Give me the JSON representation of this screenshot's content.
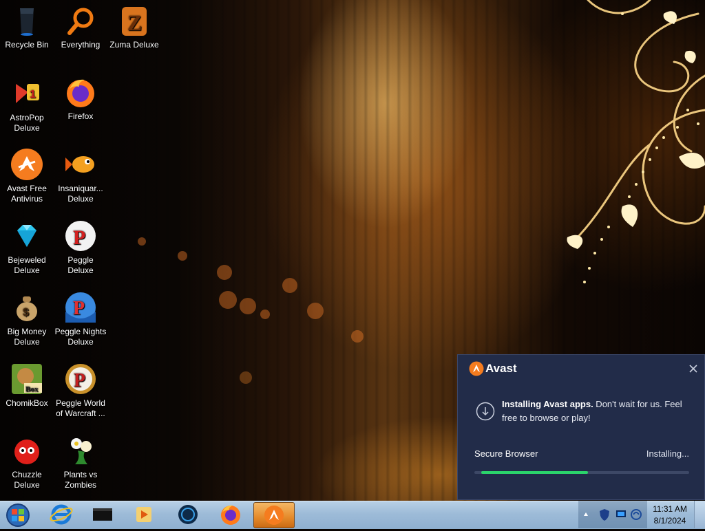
{
  "desktop": {
    "icons": [
      {
        "label": "Recycle Bin",
        "icon": "recycle-bin-icon"
      },
      {
        "label": "Everything",
        "icon": "search-icon"
      },
      {
        "label": "Zuma Deluxe",
        "icon": "zuma-icon"
      },
      {
        "label": "AstroPop Deluxe",
        "icon": "astropop-icon"
      },
      {
        "label": "Firefox",
        "icon": "firefox-icon"
      },
      {
        "label": "Avast Free Antivirus",
        "icon": "avast-icon"
      },
      {
        "label": "Insaniquar... Deluxe",
        "icon": "fish-icon"
      },
      {
        "label": "Bejeweled Deluxe",
        "icon": "diamond-icon"
      },
      {
        "label": "Peggle Deluxe",
        "icon": "peggle-icon"
      },
      {
        "label": "Big Money Deluxe",
        "icon": "money-bag-icon"
      },
      {
        "label": "Peggle Nights Deluxe",
        "icon": "peggle-nights-icon"
      },
      {
        "label": "ChomikBox",
        "icon": "chomikbox-icon"
      },
      {
        "label": "Peggle World of Warcraft ...",
        "icon": "peggle-wow-icon"
      },
      {
        "label": "Chuzzle Deluxe",
        "icon": "chuzzle-icon"
      },
      {
        "label": "Plants vs Zombies",
        "icon": "plants-icon"
      }
    ]
  },
  "popup": {
    "brand": "Avast",
    "message_bold": "Installing Avast apps.",
    "message_rest": " Don't wait for us. Feel free to browse or play!",
    "item_name": "Secure Browser",
    "item_status": "Installing...",
    "progress": 0.53,
    "accent": "#2bd46b",
    "bg": "#222c49"
  },
  "taskbar": {
    "pinned": [
      "internet-explorer-icon",
      "terminal-icon",
      "media-player-icon",
      "browser-globe-icon",
      "firefox-icon",
      "avast-icon"
    ],
    "active": "avast-icon"
  },
  "clock": {
    "time": "11:31 AM",
    "date": "8/1/2024"
  }
}
